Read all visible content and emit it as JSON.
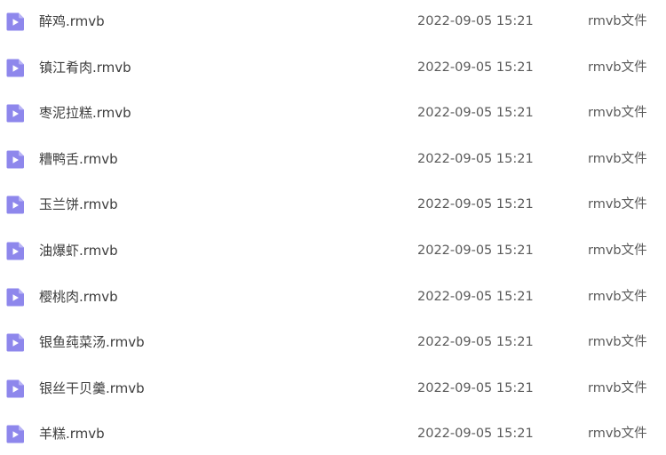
{
  "colors": {
    "icon_fill": "#8e87ec",
    "icon_fold": "#b9b4f6",
    "icon_play": "#ffffff"
  },
  "file_icon": "video-file-icon",
  "files": [
    {
      "name": "醉鸡.rmvb",
      "modified": "2022-09-05 15:21",
      "type": "rmvb文件"
    },
    {
      "name": "镇江肴肉.rmvb",
      "modified": "2022-09-05 15:21",
      "type": "rmvb文件"
    },
    {
      "name": "枣泥拉糕.rmvb",
      "modified": "2022-09-05 15:21",
      "type": "rmvb文件"
    },
    {
      "name": "糟鸭舌.rmvb",
      "modified": "2022-09-05 15:21",
      "type": "rmvb文件"
    },
    {
      "name": "玉兰饼.rmvb",
      "modified": "2022-09-05 15:21",
      "type": "rmvb文件"
    },
    {
      "name": "油爆虾.rmvb",
      "modified": "2022-09-05 15:21",
      "type": "rmvb文件"
    },
    {
      "name": "樱桃肉.rmvb",
      "modified": "2022-09-05 15:21",
      "type": "rmvb文件"
    },
    {
      "name": "银鱼莼菜汤.rmvb",
      "modified": "2022-09-05 15:21",
      "type": "rmvb文件"
    },
    {
      "name": "银丝干贝羹.rmvb",
      "modified": "2022-09-05 15:21",
      "type": "rmvb文件"
    },
    {
      "name": "羊糕.rmvb",
      "modified": "2022-09-05 15:21",
      "type": "rmvb文件"
    }
  ]
}
